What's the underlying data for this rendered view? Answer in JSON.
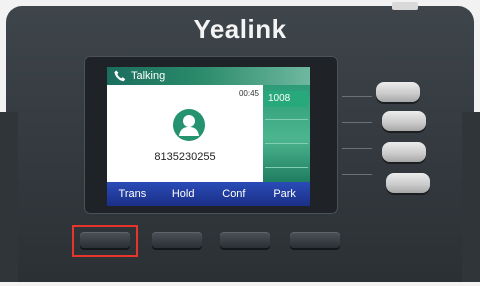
{
  "brand": "Yealink",
  "screen": {
    "status_label": "Talking",
    "timer": "00:45",
    "number": "8135230255",
    "line_label": "1008",
    "softkeys": [
      "Trans",
      "Hold",
      "Conf",
      "Park"
    ]
  },
  "colors": {
    "status_bar": "#1b6d5d",
    "line_panel": "#2c9b77",
    "softkey_bar": "#2a4cb8",
    "highlight": "#e8352c"
  },
  "icons": {
    "status": "phone-handset-icon",
    "avatar": "contact-avatar-icon"
  }
}
